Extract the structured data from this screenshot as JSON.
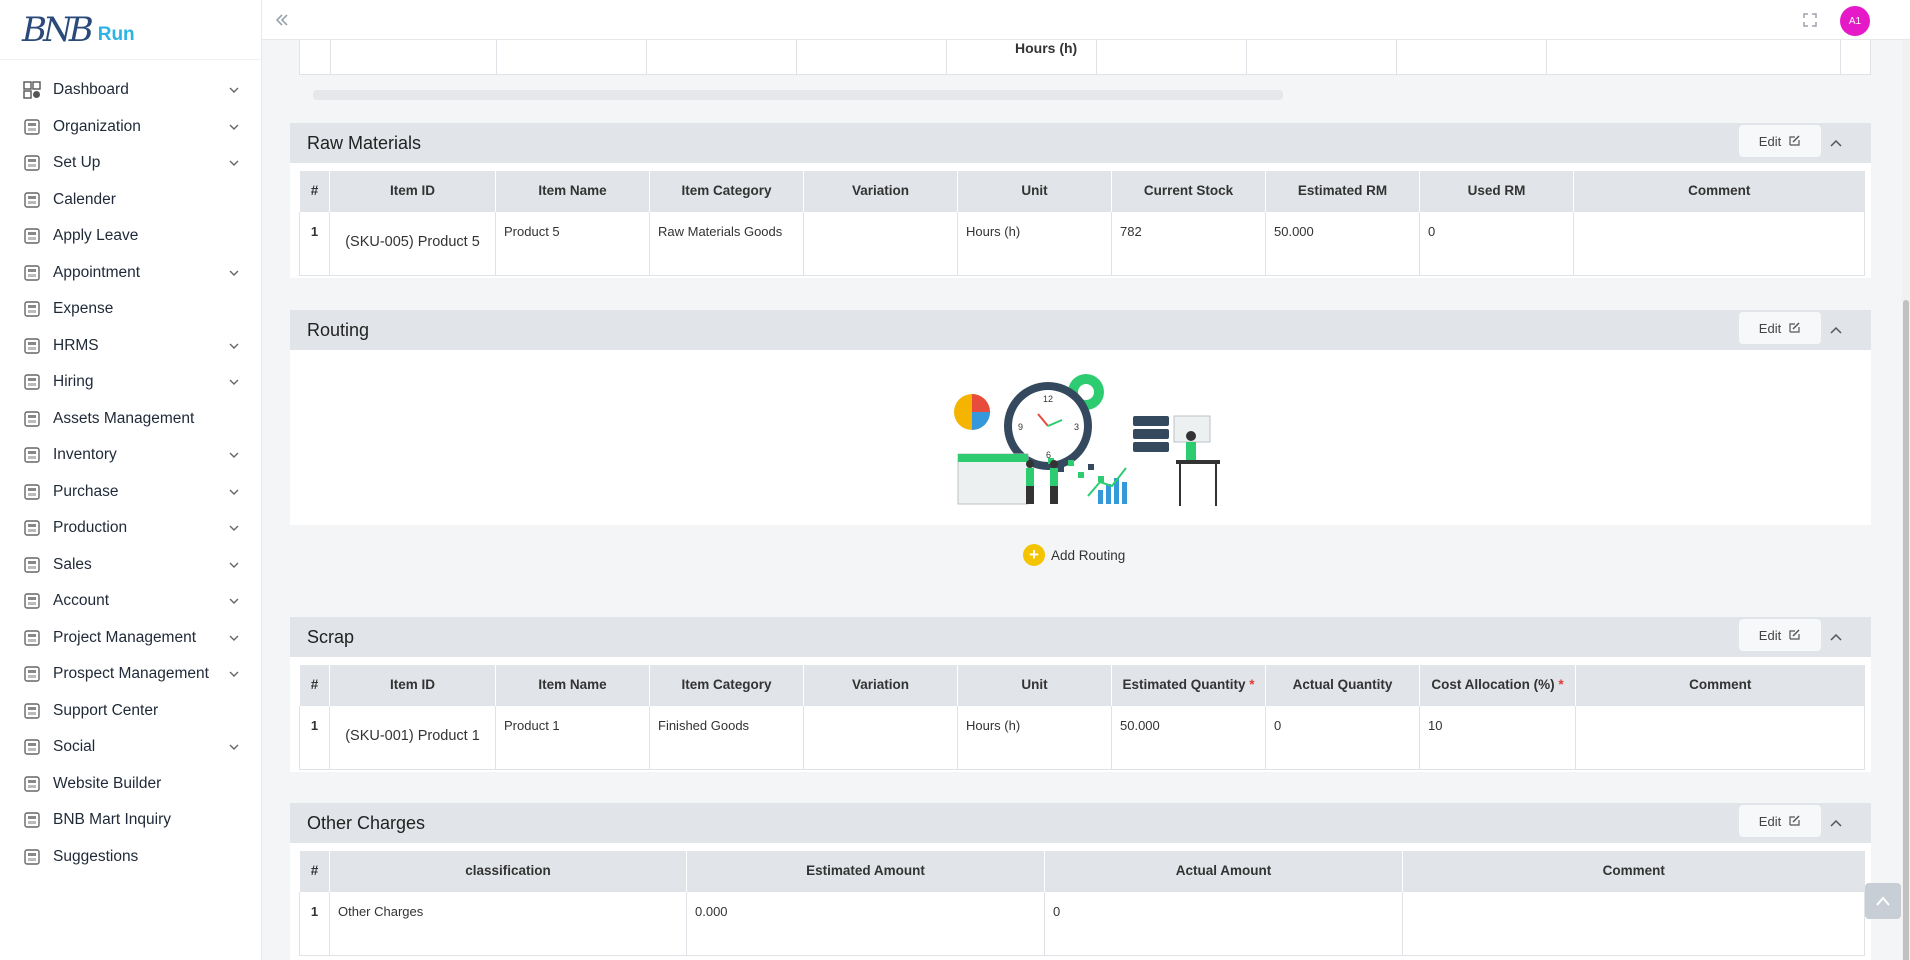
{
  "brand": {
    "mark": "BNB",
    "run": "Run"
  },
  "user": {
    "initials": "A1"
  },
  "sidebar": {
    "items": [
      {
        "label": "Dashboard",
        "icon": "dashboard-icon",
        "caret": true
      },
      {
        "label": "Organization",
        "icon": "organization-icon",
        "caret": true
      },
      {
        "label": "Set Up",
        "icon": "setup-icon",
        "caret": true
      },
      {
        "label": "Calender",
        "icon": "hourglass-icon",
        "caret": false
      },
      {
        "label": "Apply Leave",
        "icon": "leave-icon",
        "caret": false
      },
      {
        "label": "Appointment",
        "icon": "calendar-check-icon",
        "caret": true
      },
      {
        "label": "Expense",
        "icon": "expense-icon",
        "caret": false
      },
      {
        "label": "HRMS",
        "icon": "hrms-icon",
        "caret": true
      },
      {
        "label": "Hiring",
        "icon": "hiring-icon",
        "caret": true
      },
      {
        "label": "Assets Management",
        "icon": "assets-icon",
        "caret": false
      },
      {
        "label": "Inventory",
        "icon": "inventory-icon",
        "caret": true
      },
      {
        "label": "Purchase",
        "icon": "cart-icon",
        "caret": true
      },
      {
        "label": "Production",
        "icon": "factory-icon",
        "caret": true
      },
      {
        "label": "Sales",
        "icon": "sales-icon",
        "caret": true
      },
      {
        "label": "Account",
        "icon": "bank-icon",
        "caret": true
      },
      {
        "label": "Project Management",
        "icon": "project-icon",
        "caret": true
      },
      {
        "label": "Prospect Management",
        "icon": "prospect-icon",
        "caret": true
      },
      {
        "label": "Support Center",
        "icon": "support-icon",
        "caret": false
      },
      {
        "label": "Social",
        "icon": "social-icon",
        "caret": true
      },
      {
        "label": "Website Builder",
        "icon": "website-icon",
        "caret": false
      },
      {
        "label": "BNB Mart Inquiry",
        "icon": "store-icon",
        "caret": false
      },
      {
        "label": "Suggestions",
        "icon": "toggle-icon",
        "caret": false
      }
    ]
  },
  "prev_table": {
    "partial_header": "Hours (h)"
  },
  "raw_materials": {
    "title": "Raw Materials",
    "edit_label": "Edit",
    "headers": [
      "#",
      "Item ID",
      "Item Name",
      "Item Category",
      "Variation",
      "Unit",
      "Current Stock",
      "Estimated RM",
      "Used RM",
      "Comment"
    ],
    "rows": [
      [
        "1",
        "(SKU-005) Product 5",
        "Product 5",
        "Raw Materials Goods",
        "",
        "Hours (h)",
        "782",
        "50.000",
        "0",
        ""
      ]
    ]
  },
  "routing": {
    "title": "Routing",
    "edit_label": "Edit",
    "add_label": "Add Routing",
    "clock_numbers": [
      "12",
      "3",
      "6",
      "9"
    ]
  },
  "scrap": {
    "title": "Scrap",
    "edit_label": "Edit",
    "headers": [
      "#",
      "Item ID",
      "Item Name",
      "Item Category",
      "Variation",
      "Unit",
      "Estimated Quantity",
      "Actual Quantity",
      "Cost Allocation (%)",
      "Comment"
    ],
    "required": [
      false,
      false,
      false,
      false,
      false,
      false,
      true,
      false,
      true,
      false
    ],
    "rows": [
      [
        "1",
        "(SKU-001) Product 1",
        "Product 1",
        "Finished Goods",
        "",
        "Hours (h)",
        "50.000",
        "0",
        "10",
        ""
      ]
    ]
  },
  "other_charges": {
    "title": "Other Charges",
    "edit_label": "Edit",
    "headers": [
      "#",
      "classification",
      "Estimated Amount",
      "Actual Amount",
      "Comment"
    ],
    "rows": [
      [
        "1",
        "Other Charges",
        "0.000",
        "0",
        ""
      ]
    ]
  }
}
